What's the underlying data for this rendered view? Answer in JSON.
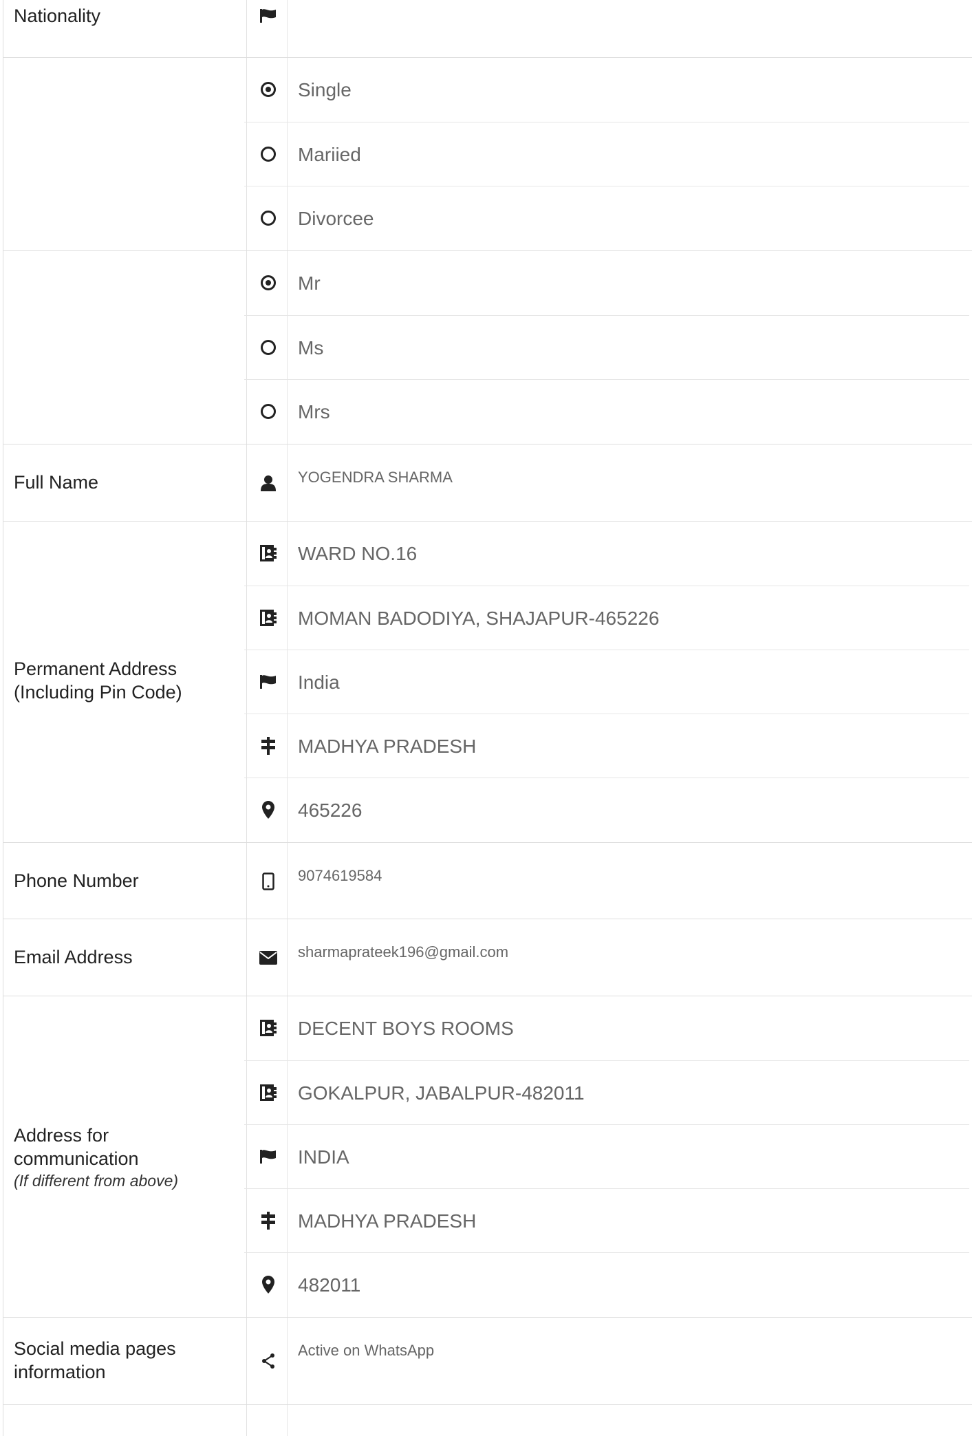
{
  "nationality": {
    "label": "Nationality"
  },
  "marital_status": {
    "options": [
      {
        "label": "Single",
        "checked": true
      },
      {
        "label": "Mariied",
        "checked": false
      },
      {
        "label": "Divorcee",
        "checked": false
      }
    ]
  },
  "title": {
    "options": [
      {
        "label": "Mr",
        "checked": true
      },
      {
        "label": "Ms",
        "checked": false
      },
      {
        "label": "Mrs",
        "checked": false
      }
    ]
  },
  "full_name": {
    "label": "Full Name",
    "value": "YOGENDRA SHARMA",
    "icon": "user-icon"
  },
  "permanent_address": {
    "label_line1": "Permanent Address",
    "label_line2": "(Including Pin Code)",
    "line1": "WARD NO.16",
    "line2": "MOMAN BADODIYA, SHAJAPUR-465226",
    "country": "India",
    "state": "MADHYA PRADESH",
    "pin": "465226"
  },
  "phone": {
    "label": "Phone Number",
    "value": "9074619584",
    "icon": "mobile-icon"
  },
  "email": {
    "label": "Email Address",
    "value": "sharmaprateek196@gmail.com",
    "icon": "envelope-icon"
  },
  "communication_address": {
    "label_line1": "Address for",
    "label_line2": "communication",
    "note": "(If different from above)",
    "line1": "DECENT BOYS ROOMS",
    "line2": "GOKALPUR, JABALPUR-482011",
    "country": "INDIA",
    "state": "MADHYA PRADESH",
    "pin": "482011"
  },
  "social": {
    "label_line1": "Social media pages",
    "label_line2": "information",
    "value": "Active on WhatsApp",
    "icon": "share-icon"
  }
}
